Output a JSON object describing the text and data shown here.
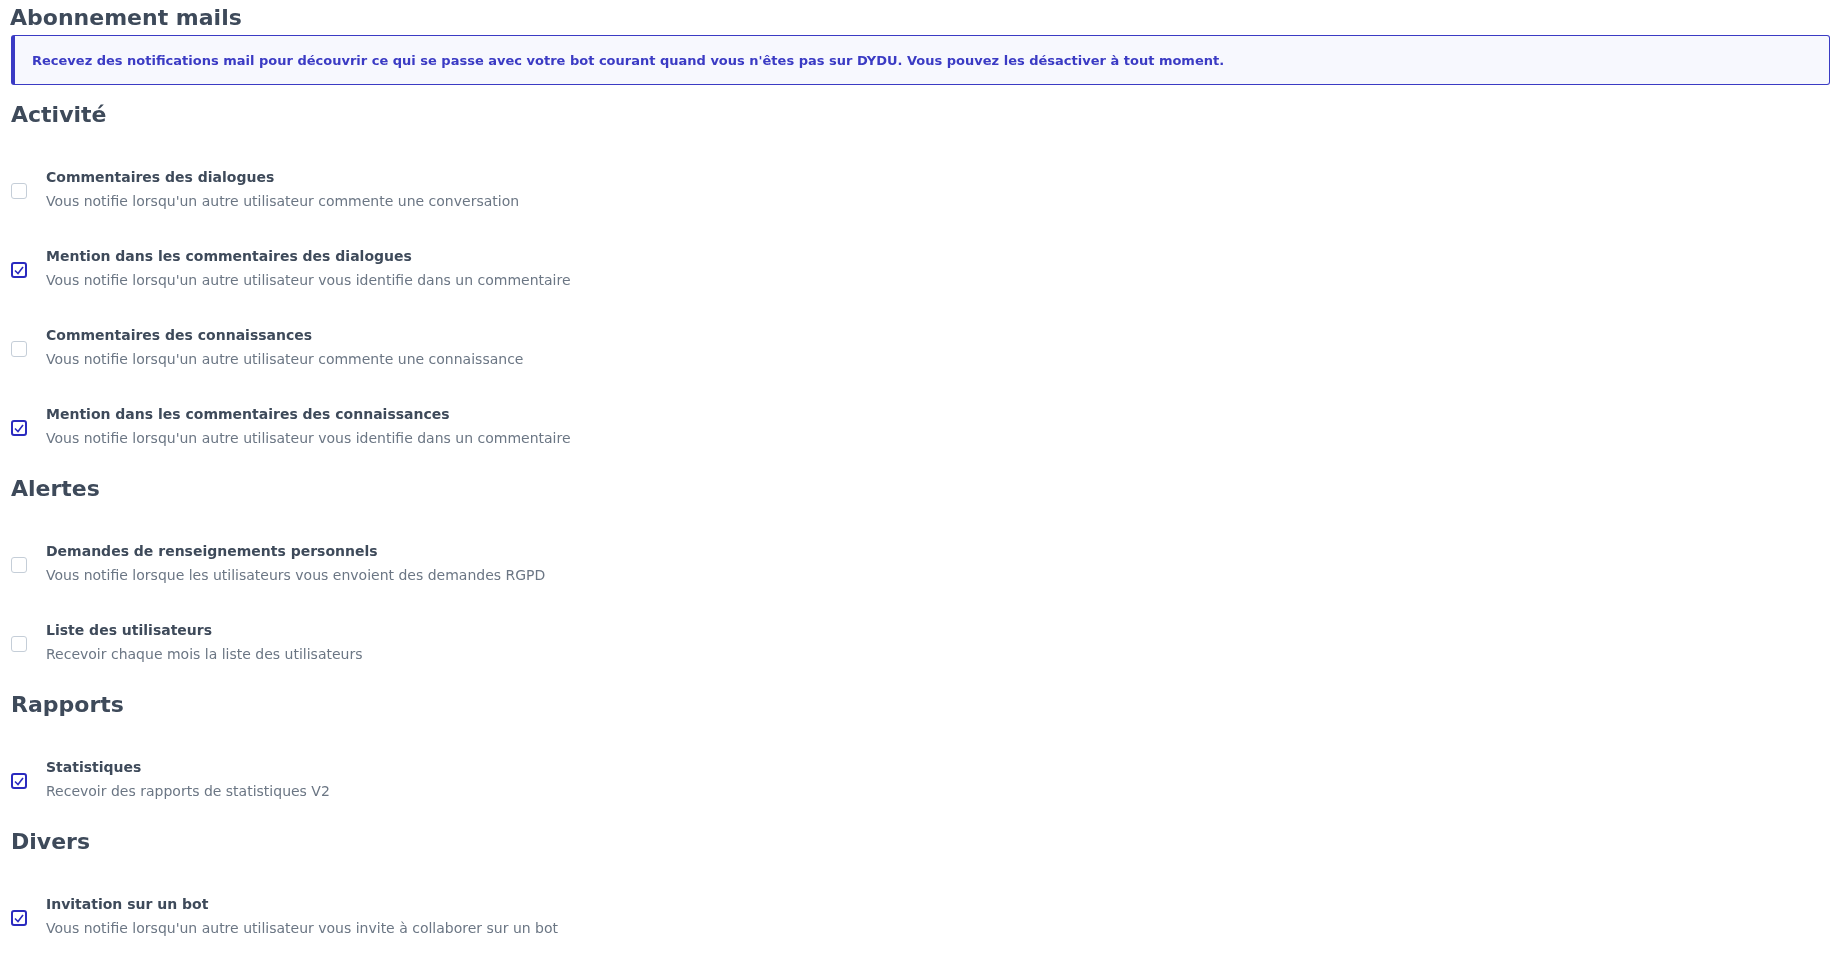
{
  "title": "Abonnement mails",
  "notice": "Recevez des notifications mail pour découvrir ce qui se passe avec votre bot courant quand vous n'êtes pas sur DYDU. Vous pouvez les désactiver à tout moment.",
  "sections": [
    {
      "heading": "Activité",
      "items": [
        {
          "label": "Commentaires des dialogues",
          "description": "Vous notifie lorsqu'un autre utilisateur commente une conversation",
          "checked": false
        },
        {
          "label": "Mention dans les commentaires des dialogues",
          "description": "Vous notifie lorsqu'un autre utilisateur vous identifie dans un commentaire",
          "checked": true
        },
        {
          "label": "Commentaires des connaissances",
          "description": "Vous notifie lorsqu'un autre utilisateur commente une connaissance",
          "checked": false
        },
        {
          "label": "Mention dans les commentaires des connaissances",
          "description": "Vous notifie lorsqu'un autre utilisateur vous identifie dans un commentaire",
          "checked": true
        }
      ]
    },
    {
      "heading": "Alertes",
      "items": [
        {
          "label": "Demandes de renseignements personnels",
          "description": "Vous notifie lorsque les utilisateurs vous envoient des demandes RGPD",
          "checked": false
        },
        {
          "label": "Liste des utilisateurs",
          "description": "Recevoir chaque mois la liste des utilisateurs",
          "checked": false
        }
      ]
    },
    {
      "heading": "Rapports",
      "items": [
        {
          "label": "Statistiques",
          "description": "Recevoir des rapports de statistiques V2",
          "checked": true
        }
      ]
    },
    {
      "heading": "Divers",
      "items": [
        {
          "label": "Invitation sur un bot",
          "description": "Vous notifie lorsqu'un autre utilisateur vous invite à collaborer sur un bot",
          "checked": true
        }
      ]
    }
  ]
}
